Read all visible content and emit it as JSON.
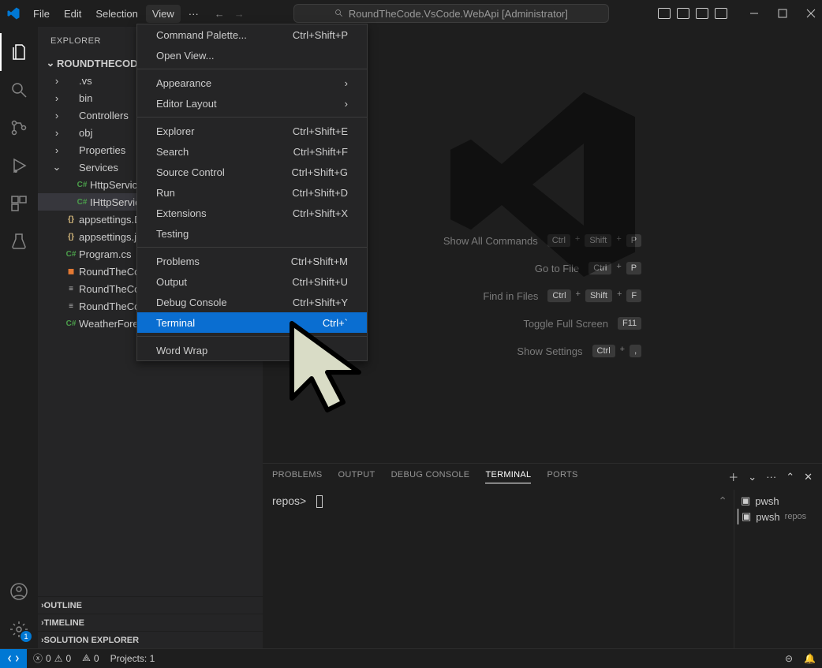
{
  "titlebar": {
    "menu": [
      "File",
      "Edit",
      "Selection",
      "View"
    ],
    "search_content": "RoundTheCode.VsCode.WebApi [Administrator]"
  },
  "explorer": {
    "title": "EXPLORER",
    "root": "ROUNDTHECODE.VS",
    "items": [
      {
        "chev": "›",
        "icon": "",
        "label": ".vs",
        "indent": 1
      },
      {
        "chev": "›",
        "icon": "",
        "label": "bin",
        "indent": 1
      },
      {
        "chev": "›",
        "icon": "",
        "label": "Controllers",
        "indent": 1
      },
      {
        "chev": "›",
        "icon": "",
        "label": "obj",
        "indent": 1
      },
      {
        "chev": "›",
        "icon": "",
        "label": "Properties",
        "indent": 1
      },
      {
        "chev": "⌄",
        "icon": "",
        "label": "Services",
        "indent": 1
      },
      {
        "chev": "",
        "icon": "C#",
        "iconCls": "ico-cs",
        "label": "HttpService.cs",
        "indent": 2
      },
      {
        "chev": "",
        "icon": "C#",
        "iconCls": "ico-cs",
        "label": "IHttpService.cs",
        "indent": 2,
        "selected": true
      },
      {
        "chev": "",
        "icon": "{}",
        "iconCls": "ico-json",
        "label": "appsettings.Deve",
        "indent": 1
      },
      {
        "chev": "",
        "icon": "{}",
        "iconCls": "ico-json",
        "label": "appsettings.json",
        "indent": 1
      },
      {
        "chev": "",
        "icon": "C#",
        "iconCls": "ico-cs",
        "label": "Program.cs",
        "indent": 1
      },
      {
        "chev": "",
        "icon": "◼",
        "iconCls": "ico-rss",
        "label": "RoundTheCode.",
        "indent": 1
      },
      {
        "chev": "",
        "icon": "≡",
        "iconCls": "ico-txt",
        "label": "RoundTheCode.",
        "indent": 1
      },
      {
        "chev": "",
        "icon": "≡",
        "iconCls": "ico-txt",
        "label": "RoundTheCode.",
        "indent": 1
      },
      {
        "chev": "",
        "icon": "C#",
        "iconCls": "ico-cs",
        "label": "WeatherForecast",
        "indent": 1
      }
    ],
    "sections": [
      "OUTLINE",
      "TIMELINE",
      "SOLUTION EXPLORER"
    ]
  },
  "viewMenu": {
    "groups": [
      [
        {
          "label": "Command Palette...",
          "accel": "Ctrl+Shift+P"
        },
        {
          "label": "Open View...",
          "accel": ""
        }
      ],
      [
        {
          "label": "Appearance",
          "arrow": true
        },
        {
          "label": "Editor Layout",
          "arrow": true
        }
      ],
      [
        {
          "label": "Explorer",
          "accel": "Ctrl+Shift+E"
        },
        {
          "label": "Search",
          "accel": "Ctrl+Shift+F"
        },
        {
          "label": "Source Control",
          "accel": "Ctrl+Shift+G"
        },
        {
          "label": "Run",
          "accel": "Ctrl+Shift+D"
        },
        {
          "label": "Extensions",
          "accel": "Ctrl+Shift+X"
        },
        {
          "label": "Testing",
          "accel": ""
        }
      ],
      [
        {
          "label": "Problems",
          "accel": "Ctrl+Shift+M"
        },
        {
          "label": "Output",
          "accel": "Ctrl+Shift+U"
        },
        {
          "label": "Debug Console",
          "accel": "Ctrl+Shift+Y"
        },
        {
          "label": "Terminal",
          "accel": "Ctrl+`",
          "hover": true
        }
      ],
      [
        {
          "label": "Word Wrap",
          "accel": ""
        }
      ]
    ]
  },
  "shortcuts": [
    {
      "label": "Show All Commands",
      "keys": [
        "Ctrl",
        "Shift",
        "P"
      ]
    },
    {
      "label": "Go to File",
      "keys": [
        "Ctrl",
        "P"
      ]
    },
    {
      "label": "Find in Files",
      "keys": [
        "Ctrl",
        "Shift",
        "F"
      ]
    },
    {
      "label": "Toggle Full Screen",
      "keys": [
        "F11"
      ]
    },
    {
      "label": "Show Settings",
      "keys": [
        "Ctrl",
        ","
      ]
    }
  ],
  "panel": {
    "tabs": [
      "PROBLEMS",
      "OUTPUT",
      "DEBUG CONSOLE",
      "TERMINAL",
      "PORTS"
    ],
    "active_tab": 3,
    "prompt": "repos>",
    "terminals": [
      {
        "name": "pwsh",
        "sub": "",
        "active": false
      },
      {
        "name": "pwsh",
        "sub": "repos",
        "active": true
      }
    ]
  },
  "status": {
    "errors": "0",
    "warnings": "0",
    "ports": "0",
    "projects": "Projects: 1"
  },
  "gear_badge": "1"
}
